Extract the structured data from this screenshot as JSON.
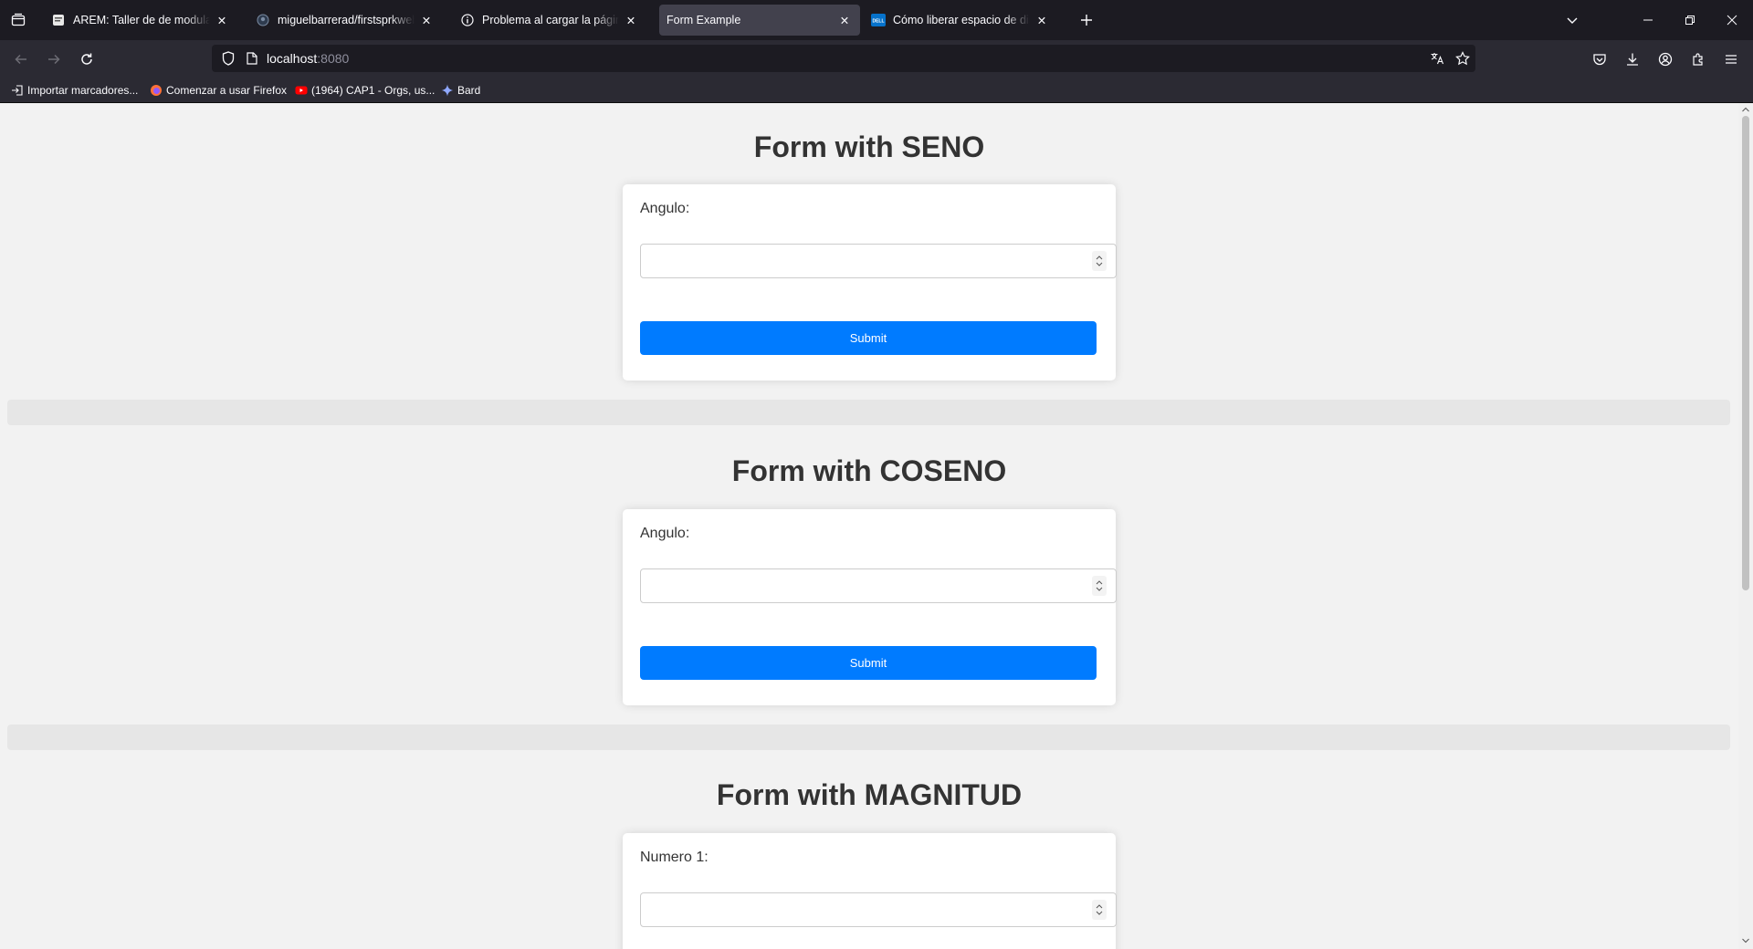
{
  "browser": {
    "tabs": [
      {
        "title": "AREM: Taller de de modularización",
        "favicon": "document-icon"
      },
      {
        "title": "miguelbarrerad/firstsprkwebapp",
        "favicon": "github-icon"
      },
      {
        "title": "Problema al cargar la página",
        "favicon": "info-icon"
      },
      {
        "title": "Form Example",
        "favicon": "none"
      },
      {
        "title": "Cómo liberar espacio de disco duro",
        "favicon": "dell-icon"
      }
    ],
    "active_tab_index": 3,
    "url_host": "localhost",
    "url_port": ":8080",
    "bookmarks": [
      {
        "label": "Importar marcadores...",
        "icon": "import-icon"
      },
      {
        "label": "Comenzar a usar Firefox",
        "icon": "firefox-icon"
      },
      {
        "label": "(1964) CAP1 - Orgs, us...",
        "icon": "youtube-icon"
      },
      {
        "label": "Bard",
        "icon": "sparkle-icon"
      }
    ],
    "dell_badge": "DELL"
  },
  "page": {
    "sections": [
      {
        "title": "Form with SENO",
        "field_label": "Angulo:",
        "button": "Submit"
      },
      {
        "title": "Form with COSENO",
        "field_label": "Angulo:",
        "button": "Submit"
      },
      {
        "title": "Form with MAGNITUD",
        "field_label": "Numero 1:"
      }
    ]
  }
}
